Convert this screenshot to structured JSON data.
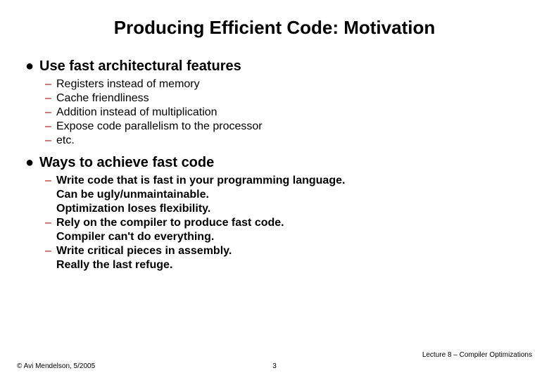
{
  "title": "Producing Efficient Code: Motivation",
  "bullet1": {
    "marker": "●",
    "text": "Use fast architectural features",
    "sub": [
      {
        "dash": "–",
        "text": "Registers instead of memory"
      },
      {
        "dash": "–",
        "text": "Cache friendliness"
      },
      {
        "dash": "–",
        "text": "Addition instead of multiplication"
      },
      {
        "dash": "–",
        "text": "Expose code parallelism to the processor"
      },
      {
        "dash": "–",
        "text": "etc."
      }
    ]
  },
  "bullet2": {
    "marker": "●",
    "text": "Ways to achieve fast code",
    "sub": [
      {
        "dash": "–",
        "text": "Write code that is fast in your programming language.",
        "cont": [
          "Can be ugly/unmaintainable.",
          "Optimization loses flexibility."
        ]
      },
      {
        "dash": "–",
        "text": "Rely on the compiler to produce fast code.",
        "cont": [
          "Compiler can't do everything."
        ]
      },
      {
        "dash": "–",
        "text": "Write critical pieces in assembly.",
        "cont": [
          "Really the last refuge."
        ]
      }
    ]
  },
  "footer": {
    "right": "Lecture 8 – Compiler Optimizations",
    "left": "© Avi Mendelson, 5/2005",
    "center": "3"
  }
}
